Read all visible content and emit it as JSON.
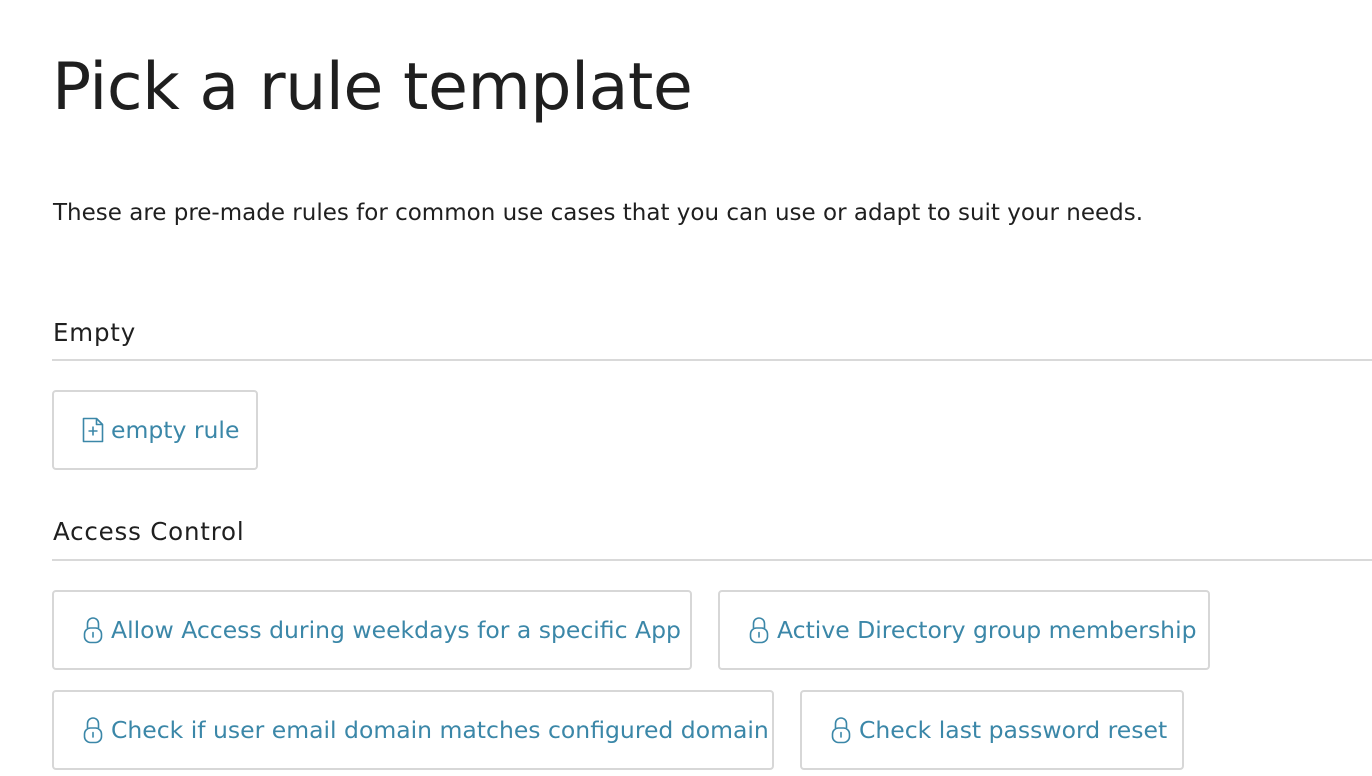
{
  "page": {
    "title": "Pick a rule template",
    "description": "These are pre-made rules for common use cases that you can use or adapt to suit your needs."
  },
  "sections": {
    "empty": {
      "heading": "Empty",
      "items": [
        {
          "label": "empty rule",
          "icon": "new-document-icon"
        }
      ]
    },
    "access_control": {
      "heading": "Access Control",
      "items": [
        {
          "label": "Allow Access during weekdays for a specific App",
          "icon": "lock-icon"
        },
        {
          "label": "Active Directory group membership",
          "icon": "lock-icon"
        },
        {
          "label": "Check if user email domain matches configured domain",
          "icon": "lock-icon"
        },
        {
          "label": "Check last password reset",
          "icon": "lock-icon"
        }
      ]
    }
  },
  "colors": {
    "link": "#3b87a8",
    "text": "#1f1f1f",
    "border": "#d7d7d7"
  }
}
